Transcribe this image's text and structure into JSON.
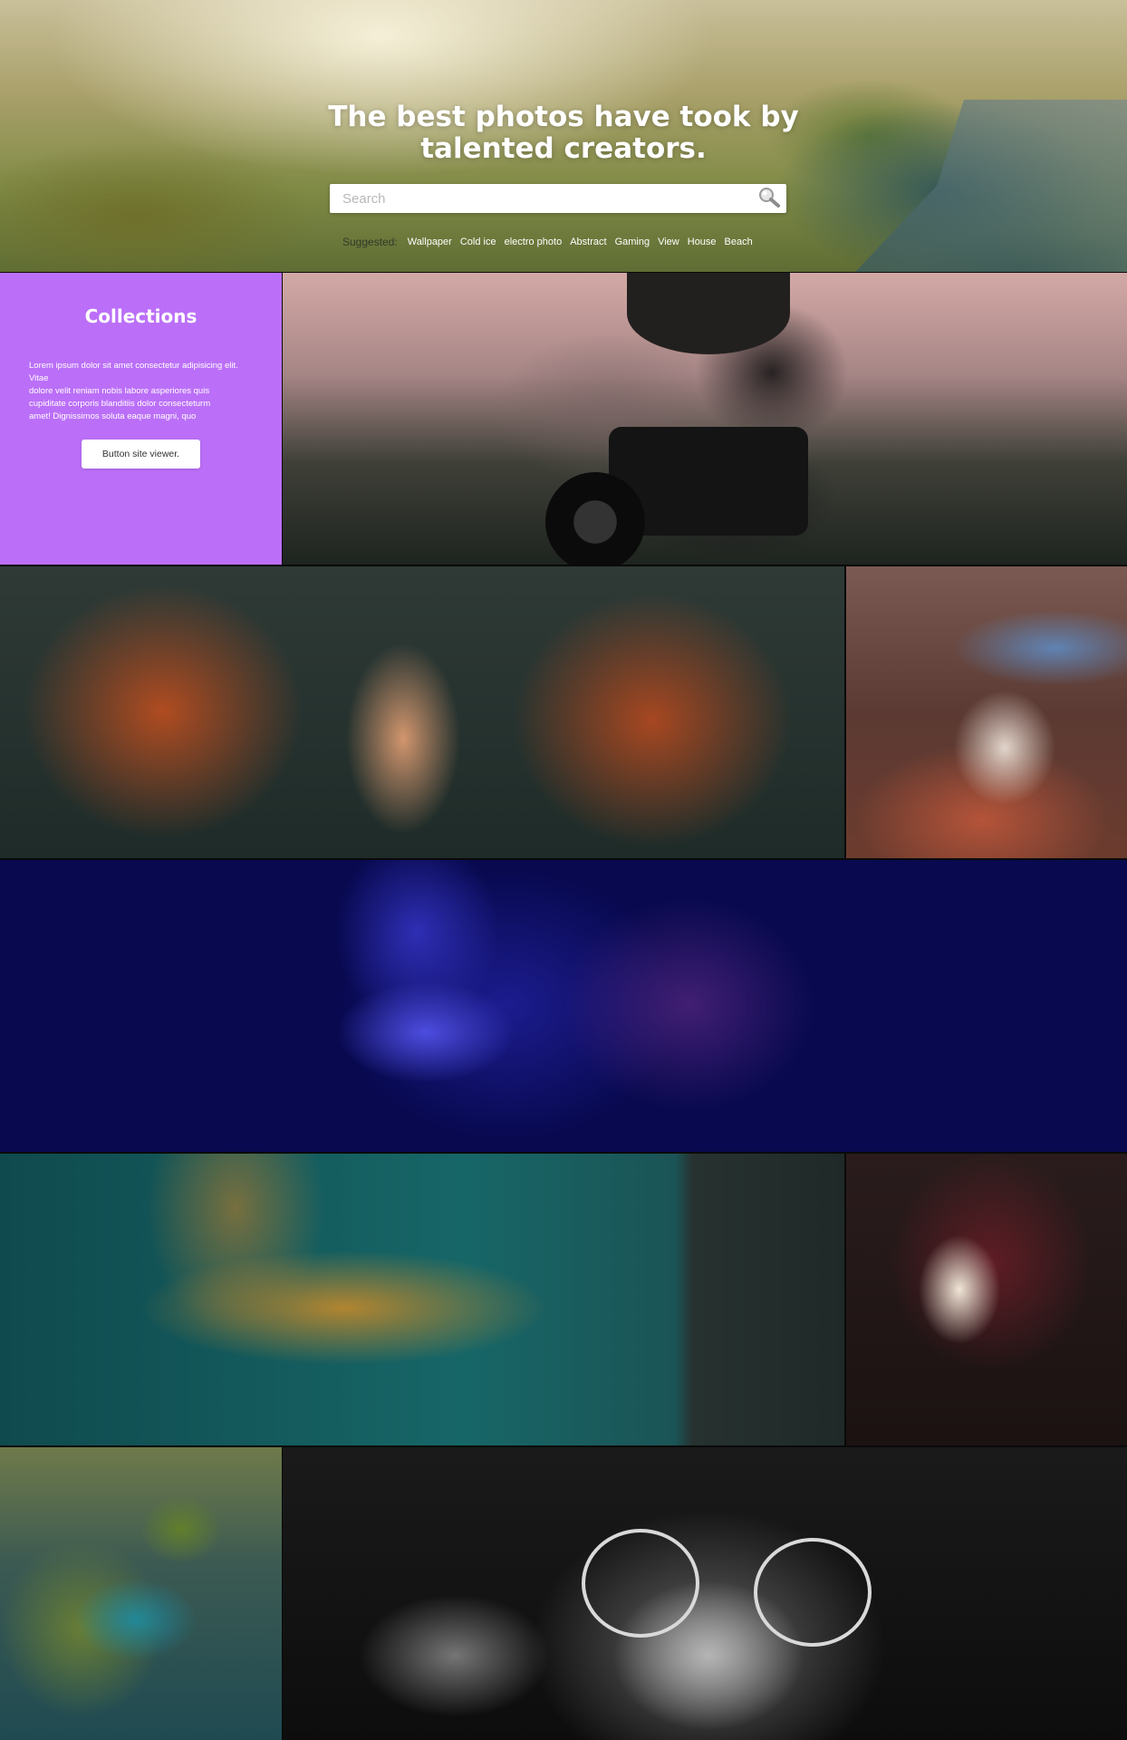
{
  "hero": {
    "title_line1": "The best photos have took by",
    "title_line2": "talented creators.",
    "search": {
      "placeholder": "Search",
      "icon": "search-icon"
    },
    "suggested": {
      "label": "Suggested:",
      "tags": [
        "Wallpaper",
        "Cold ice",
        "electro photo",
        "Abstract",
        "Gaming",
        "View",
        "House",
        "Beach"
      ]
    }
  },
  "collections": {
    "title": "Collections",
    "description_lines": [
      "Lorem ipsum dolor sit amet consectetur adipisicing elit. Vitae",
      "dolore velit reniam nobis labore asperiores quis",
      "cupiditate corporis blanditiis dolor consecteturm",
      "amet! Dignissimos soluta eaque magni, quo"
    ],
    "button_label": "Button site viewer.",
    "background_color": "#bb6ff8"
  },
  "gallery": [
    {
      "name": "photographer-with-camera"
    },
    {
      "name": "hand-in-leaves"
    },
    {
      "name": "neon-mask-cards"
    },
    {
      "name": "blue-lips-glitter"
    },
    {
      "name": "larch-branch-lake"
    },
    {
      "name": "floating-queen-card"
    },
    {
      "name": "aerial-island-coast"
    },
    {
      "name": "woman-round-glasses"
    }
  ]
}
